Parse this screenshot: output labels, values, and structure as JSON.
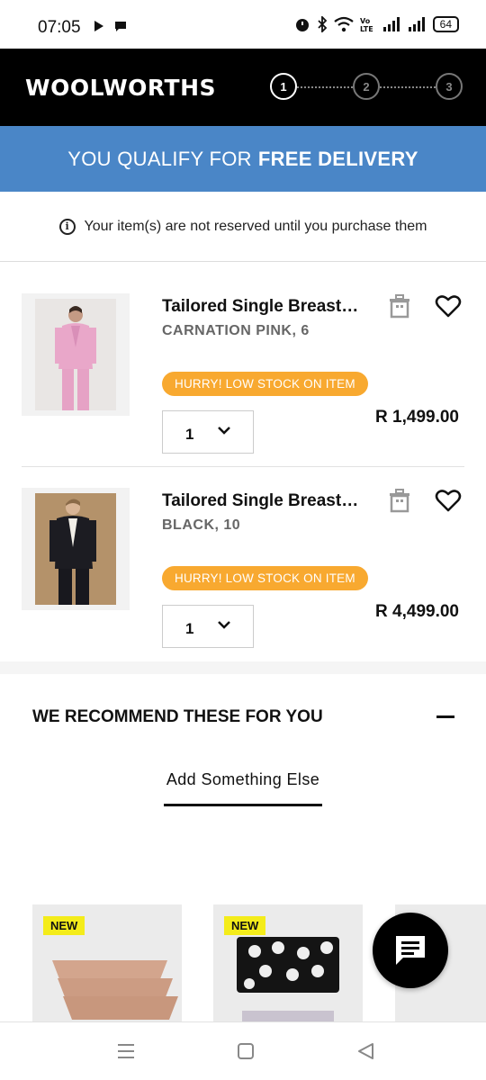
{
  "status_bar": {
    "time": "07:05",
    "battery": "64",
    "icons": [
      "play-icon",
      "chat-bubble-icon",
      "alarm-icon",
      "bluetooth-icon",
      "wifi-icon",
      "volte-icon",
      "signal-icon",
      "signal-icon",
      "battery-icon"
    ]
  },
  "header": {
    "logo": "WOOLWORTHS",
    "steps": [
      "1",
      "2",
      "3"
    ],
    "active_step": "1"
  },
  "banner": {
    "text": "YOU QUALIFY FOR",
    "emphasis": "FREE DELIVERY",
    "color": "#4a86c7"
  },
  "notice": {
    "text": "Your item(s) are not reserved until you purchase them"
  },
  "cart": {
    "items": [
      {
        "title": "Tailored Single Breasted Blazer",
        "variant": "CARNATION PINK, 6",
        "badge": "HURRY! LOW STOCK ON ITEM",
        "quantity": "1",
        "price": "R 1,499.00"
      },
      {
        "title": "Tailored Single Breasted Blazer",
        "variant": "BLACK, 10",
        "badge": "HURRY! LOW STOCK ON ITEM",
        "quantity": "1",
        "price": "R 4,499.00"
      }
    ],
    "badge_color": "#f8a930"
  },
  "recommendations": {
    "title": "WE RECOMMEND THESE FOR YOU",
    "tab": "Add Something Else",
    "products": [
      {
        "badge": "NEW"
      },
      {
        "badge": "NEW"
      },
      {
        "badge": ""
      }
    ]
  }
}
